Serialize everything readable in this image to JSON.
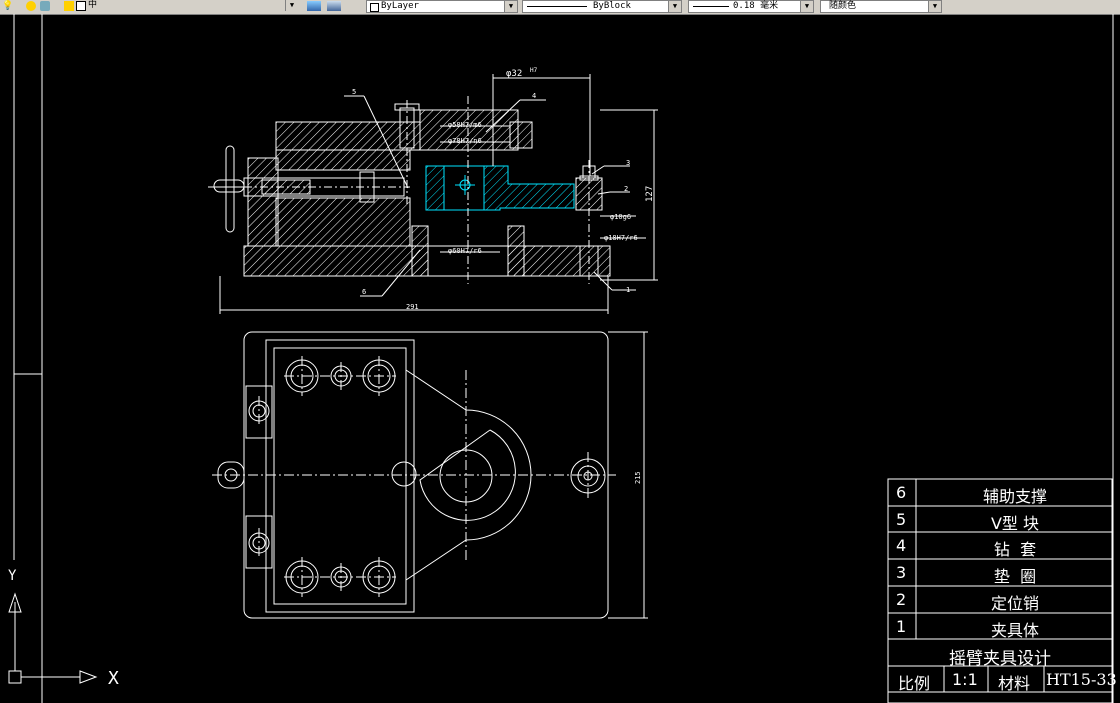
{
  "toolbar": {
    "layer_name": "中",
    "linetype_layer": "ByLayer",
    "linetype_block": "ByBlock",
    "lineweight": "0.18 毫米",
    "color": "随颜色"
  },
  "drawing": {
    "dims": {
      "top_diameter": "φ32",
      "top_fit": "H7",
      "fit_58": "φ58H7/m6",
      "fit_78": "φ78H7/n6",
      "fit_10": "φ10g6",
      "fit_18": "φ18H7/r6",
      "fit_60": "φ60H7/r6",
      "height": "127",
      "length": "291",
      "width": "215"
    },
    "leaders": [
      "5",
      "4",
      "3",
      "2",
      "6",
      "1"
    ]
  },
  "title_block": {
    "parts": [
      {
        "no": "6",
        "name": "辅助支撑"
      },
      {
        "no": "5",
        "name": "V型 块"
      },
      {
        "no": "4",
        "name": "钻  套"
      },
      {
        "no": "3",
        "name": "垫  圈"
      },
      {
        "no": "2",
        "name": "定位销"
      },
      {
        "no": "1",
        "name": "夹具体"
      }
    ],
    "title": "摇臂夹具设计",
    "scale_label": "比例",
    "scale_value": "1:1",
    "material_label": "材料",
    "material_value": "HT15-33"
  },
  "ucs": {
    "x_label": "X",
    "y_label": "Y"
  },
  "colors": {
    "background": "#000000",
    "lines": "#ffffff",
    "highlight": "#00e5ff"
  }
}
